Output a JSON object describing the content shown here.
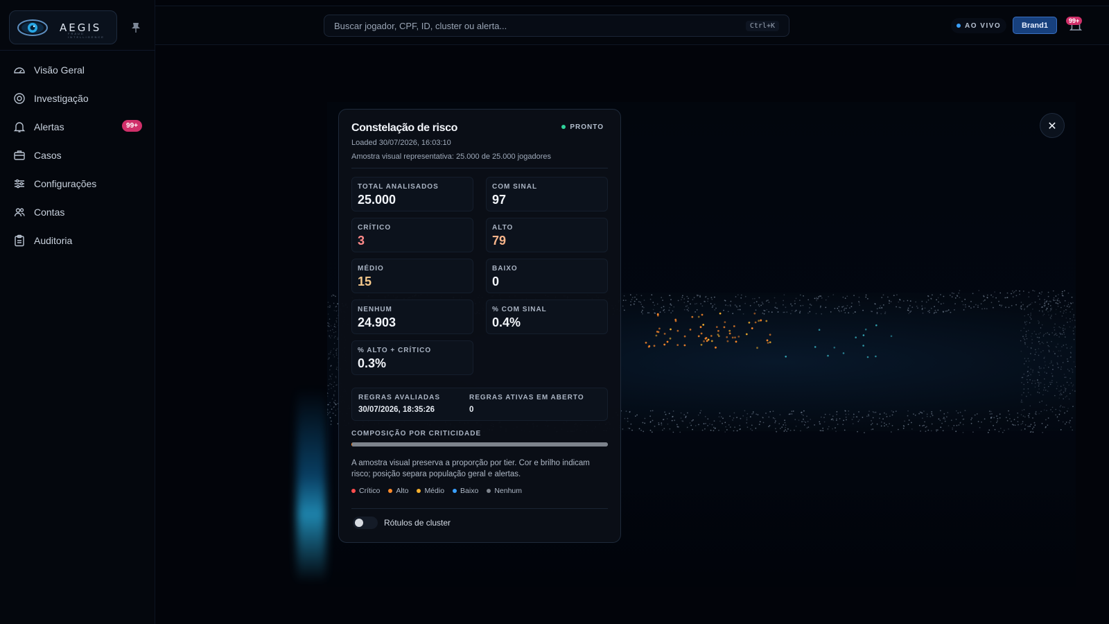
{
  "brand": {
    "name": "AEGIS",
    "tagline": "FRAUD INTELLIGENCE"
  },
  "sidebar": {
    "items": [
      {
        "label": "Visão Geral",
        "icon": "gauge-icon"
      },
      {
        "label": "Investigação",
        "icon": "target-icon"
      },
      {
        "label": "Alertas",
        "icon": "bell-icon",
        "badge": "99+"
      },
      {
        "label": "Casos",
        "icon": "briefcase-icon"
      },
      {
        "label": "Configurações",
        "icon": "sliders-icon"
      },
      {
        "label": "Contas",
        "icon": "users-icon"
      },
      {
        "label": "Auditoria",
        "icon": "clipboard-icon"
      }
    ]
  },
  "topbar": {
    "search_placeholder": "Buscar jogador, CPF, ID, cluster ou alerta...",
    "shortcut": "Ctrl+K",
    "live_label": "AO VIVO",
    "brand_button": "Brand1",
    "notifications_badge": "99+"
  },
  "panel": {
    "title": "Constelação de risco",
    "status": "PRONTO",
    "loaded": "Loaded 30/07/2026, 16:03:10",
    "sample": "Amostra visual representativa: 25.000 de 25.000 jogadores",
    "stats": [
      {
        "label": "TOTAL ANALISADOS",
        "value": "25.000",
        "color": "#f2f5fa"
      },
      {
        "label": "COM SINAL",
        "value": "97",
        "color": "#f2f5fa"
      },
      {
        "label": "CRÍTICO",
        "value": "3",
        "color": "#ff8a8a"
      },
      {
        "label": "ALTO",
        "value": "79",
        "color": "#f7b48a"
      },
      {
        "label": "MÉDIO",
        "value": "15",
        "color": "#f6c98c"
      },
      {
        "label": "BAIXO",
        "value": "0",
        "color": "#f2f5fa"
      },
      {
        "label": "NENHUM",
        "value": "24.903",
        "color": "#f2f5fa"
      },
      {
        "label": "% COM SINAL",
        "value": "0.4%",
        "color": "#f2f5fa"
      },
      {
        "label": "% ALTO + CRÍTICO",
        "value": "0.3%",
        "color": "#f2f5fa"
      }
    ],
    "rules_evaluated_label": "REGRAS AVALIADAS",
    "rules_evaluated_value": "30/07/2026, 18:35:26",
    "rules_open_label": "REGRAS ATIVAS EM ABERTO",
    "rules_open_value": "0",
    "composition_title": "COMPOSIÇÃO POR CRITICIDADE",
    "composition_note": "A amostra visual preserva a proporção por tier. Cor e brilho indicam risco; posição separa população geral e alertas.",
    "legend": [
      {
        "label": "Crítico",
        "color": "#ff4d4d"
      },
      {
        "label": "Alto",
        "color": "#ff8a2a"
      },
      {
        "label": "Médio",
        "color": "#f5b02e"
      },
      {
        "label": "Baixo",
        "color": "#3aa0ff"
      },
      {
        "label": "Nenhum",
        "color": "#7d838c"
      }
    ],
    "toggle_label": "Rótulos de cluster",
    "toggle_on": false
  }
}
